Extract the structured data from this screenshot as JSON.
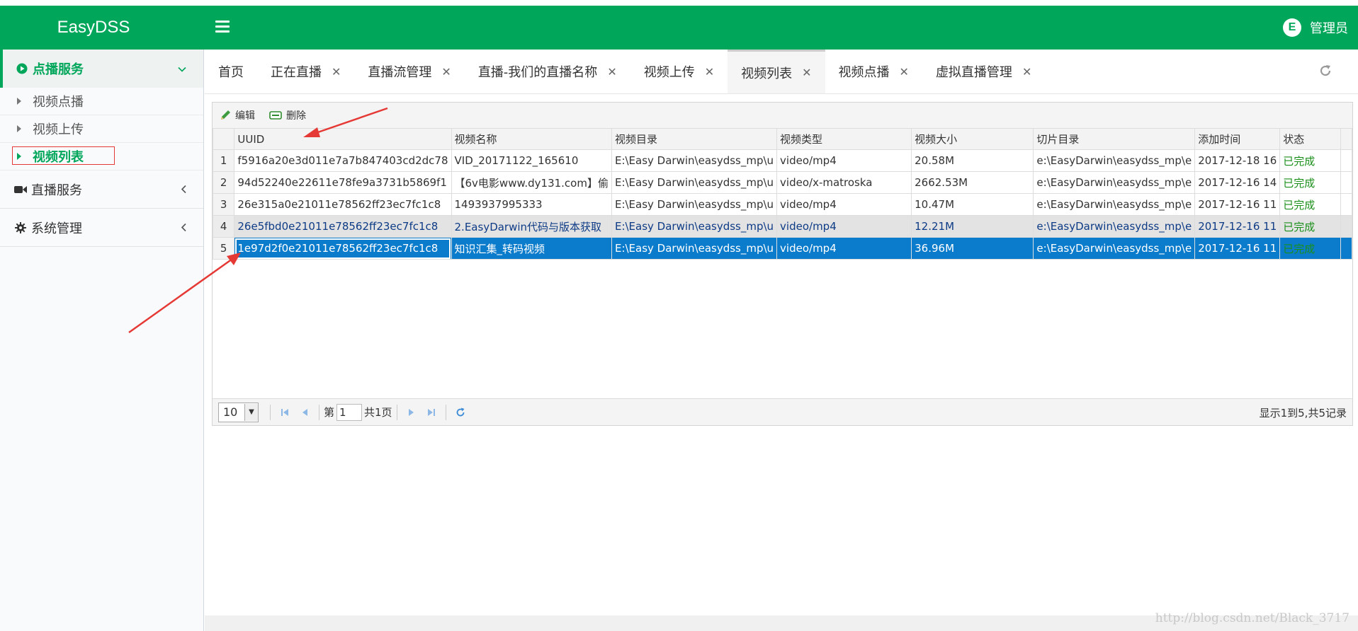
{
  "header": {
    "brand": "EasyDSS",
    "user_name": "管理员",
    "user_avatar_letter": "E"
  },
  "sidebar": {
    "sections": [
      {
        "label": "点播服务",
        "icon": "play-circle-icon",
        "expanded": true,
        "items": [
          {
            "label": "视频点播"
          },
          {
            "label": "视频上传"
          },
          {
            "label": "视频列表",
            "active": true
          }
        ]
      },
      {
        "label": "直播服务",
        "icon": "video-camera-icon"
      },
      {
        "label": "系统管理",
        "icon": "gear-icon"
      }
    ]
  },
  "tabs": [
    {
      "label": "首页",
      "closable": false
    },
    {
      "label": "正在直播",
      "closable": true
    },
    {
      "label": "直播流管理",
      "closable": true
    },
    {
      "label": "直播-我们的直播名称",
      "closable": true
    },
    {
      "label": "视频上传",
      "closable": true
    },
    {
      "label": "视频列表",
      "closable": true,
      "active": true
    },
    {
      "label": "视频点播",
      "closable": true
    },
    {
      "label": "虚拟直播管理",
      "closable": true
    }
  ],
  "toolbar": {
    "edit_label": "编辑",
    "delete_label": "删除"
  },
  "table": {
    "columns": [
      "UUID",
      "视频名称",
      "视频目录",
      "视频类型",
      "视频大小",
      "切片目录",
      "添加时间",
      "状态"
    ],
    "rows": [
      {
        "n": "1",
        "uuid": "f5916a20e3d011e7a7b847403cd2dc78",
        "name": "VID_20171122_165610",
        "dir": "E:\\Easy Darwin\\easydss_mp\\u",
        "type": "video/mp4",
        "size": "20.58M",
        "slice": "e:\\EasyDarwin\\easydss_mp\\e",
        "time": "2017-12-18 16",
        "status": "已完成"
      },
      {
        "n": "2",
        "uuid": "94d52240e22611e78fe9a3731b5869f1",
        "name": "【6v电影www.dy131.com】偷",
        "dir": "E:\\Easy Darwin\\easydss_mp\\u",
        "type": "video/x-matroska",
        "size": "2662.53M",
        "slice": "e:\\EasyDarwin\\easydss_mp\\e",
        "time": "2017-12-16 14",
        "status": "已完成"
      },
      {
        "n": "3",
        "uuid": "26e315a0e21011e78562ff23ec7fc1c8",
        "name": "1493937995333",
        "dir": "E:\\Easy Darwin\\easydss_mp\\u",
        "type": "video/mp4",
        "size": "10.47M",
        "slice": "e:\\EasyDarwin\\easydss_mp\\e",
        "time": "2017-12-16 11",
        "status": "已完成"
      },
      {
        "n": "4",
        "uuid": "26e5fbd0e21011e78562ff23ec7fc1c8",
        "name": "2.EasyDarwin代码与版本获取",
        "dir": "E:\\Easy Darwin\\easydss_mp\\u",
        "type": "video/mp4",
        "size": "12.21M",
        "slice": "e:\\EasyDarwin\\easydss_mp\\e",
        "time": "2017-12-16 11",
        "status": "已完成"
      },
      {
        "n": "5",
        "uuid": "1e97d2f0e21011e78562ff23ec7fc1c8",
        "name": "知识汇集_转码视频",
        "dir": "E:\\Easy Darwin\\easydss_mp\\u",
        "type": "video/mp4",
        "size": "36.96M",
        "slice": "e:\\EasyDarwin\\easydss_mp\\e",
        "time": "2017-12-16 11",
        "status": "已完成"
      }
    ],
    "status_color": "#1a8f1a",
    "selected_color": "#0b7bcc"
  },
  "pager": {
    "page_size": "10",
    "page_prefix": "第",
    "page_value": "1",
    "page_total": "共1页",
    "summary": "显示1到5,共5记录"
  },
  "watermark": "http://blog.csdn.net/Black_3717",
  "colors": {
    "brand_green": "#00a65a",
    "annotation_red": "#e53935"
  }
}
